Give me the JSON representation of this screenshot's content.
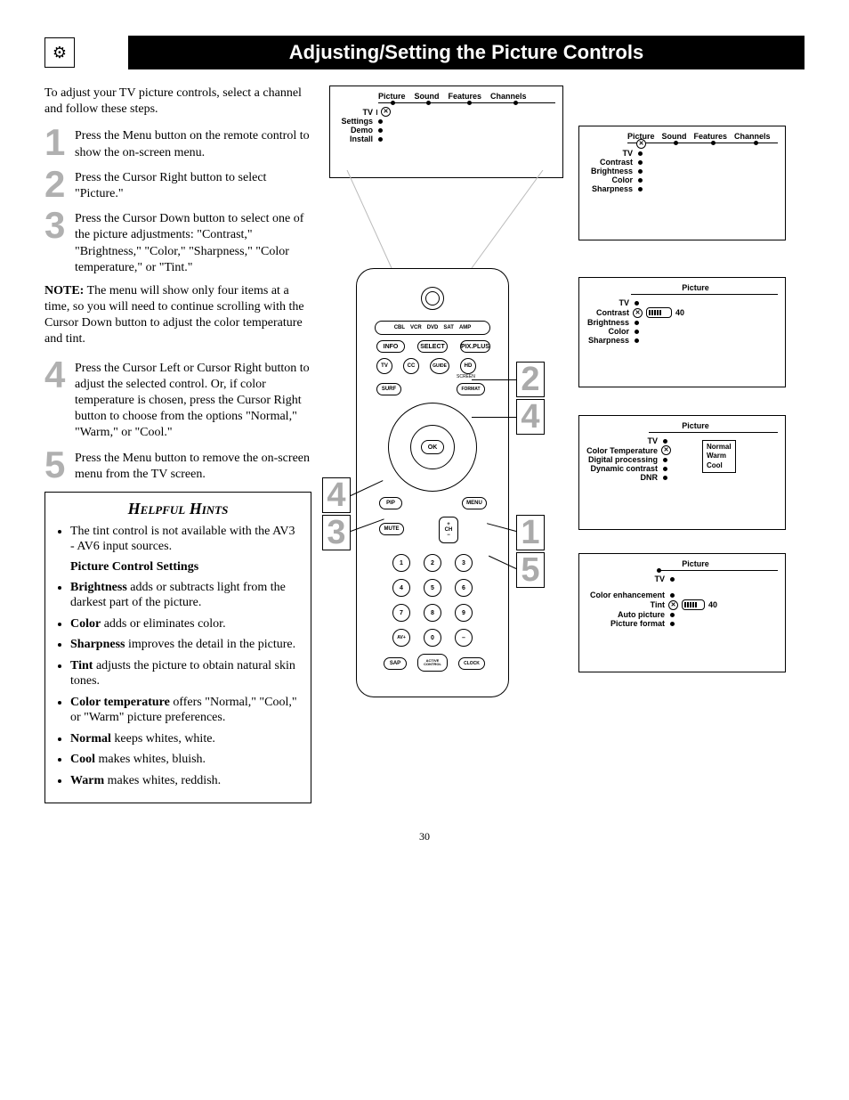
{
  "title": "Adjusting/Setting the Picture Controls",
  "intro": "To adjust your TV picture controls, select a channel and follow these steps.",
  "steps": [
    {
      "n": "1",
      "t": "Press the Menu button on the remote control to show the on-screen menu."
    },
    {
      "n": "2",
      "t": "Press the Cursor Right button to select \"Picture.\""
    },
    {
      "n": "3",
      "t": "Press the Cursor Down button to select one of the picture adjustments: \"Contrast,\" \"Brightness,\" \"Color,\" \"Sharpness,\" \"Color temperature,\" or \"Tint.\""
    },
    {
      "n": "4",
      "t": "Press the Cursor Left or Cursor Right button to adjust the selected control. Or, if color temperature is chosen, press the Cursor Right button to choose from the options \"Normal,\" \"Warm,\" or \"Cool.\""
    },
    {
      "n": "5",
      "t": "Press the Menu button to remove the on-screen menu from the TV screen."
    }
  ],
  "note_label": "NOTE:",
  "note": "The menu will show only four items at a time, so you will need to continue scrolling with the Cursor Down button to adjust the color temperature and tint.",
  "hints_title": "Helpful Hints",
  "hints_intro": "The tint control is not available with the AV3 -  AV6 input sources.",
  "hints_sub": "Picture Control Settings",
  "hints_items": [
    {
      "b": "Brightness",
      "t": " adds or subtracts light from the darkest part of the picture."
    },
    {
      "b": "Color",
      "t": " adds or eliminates color."
    },
    {
      "b": "Sharpness",
      "t": " improves the detail in the picture."
    },
    {
      "b": "Tint",
      "t": " adjusts the picture to obtain natural skin tones."
    },
    {
      "b": "Color temperature",
      "t": " offers \"Normal,\" \"Cool,\" or \"Warm\" picture preferences."
    },
    {
      "b": "Normal",
      "t": " keeps whites, white."
    },
    {
      "b": "Cool",
      "t": " makes whites, bluish."
    },
    {
      "b": "Warm",
      "t": " makes whites, reddish."
    }
  ],
  "menu_top": {
    "row": [
      "Picture",
      "Sound",
      "Features",
      "Channels"
    ],
    "col": [
      "TV",
      "Settings",
      "Demo",
      "Install"
    ]
  },
  "menu1": {
    "row": [
      "Picture",
      "Sound",
      "Features",
      "Channels"
    ],
    "col": [
      "TV",
      "Contrast",
      "Brightness",
      "Color",
      "Sharpness"
    ]
  },
  "menu2": {
    "header": "Picture",
    "col": [
      "TV",
      "Contrast",
      "Brightness",
      "Color",
      "Sharpness"
    ],
    "val": "40"
  },
  "menu3": {
    "header": "Picture",
    "col": [
      "TV",
      "Color Temperature",
      "Digital processing",
      "Dynamic contrast",
      "DNR"
    ],
    "opts": [
      "Normal",
      "Warm",
      "Cool"
    ]
  },
  "menu4": {
    "header": "Picture",
    "col": [
      "TV",
      "Color enhancement",
      "Tint",
      "Auto picture",
      "Picture format"
    ],
    "val": "40"
  },
  "remote": {
    "row_labels": [
      "CBL",
      "VCR",
      "DVD",
      "SAT",
      "AMP"
    ],
    "info": "INFO",
    "select": "SELECT",
    "pixplus": "PIX.PLUS",
    "tv": "TV",
    "cc": "CC",
    "guide": "GUIDE",
    "hd": "HD",
    "surf": "SURF",
    "screen": "SCREEN",
    "format": "FORMAT",
    "ok": "OK",
    "pip": "PIP",
    "menu": "MENU",
    "mute": "MUTE",
    "ch": "CH",
    "avplus": "AV+",
    "sap": "SAP",
    "active": "ACTIVE\nCONTROL",
    "clock": "CLOCK"
  },
  "callouts": [
    "1",
    "2",
    "3",
    "4",
    "5"
  ],
  "page": "30"
}
